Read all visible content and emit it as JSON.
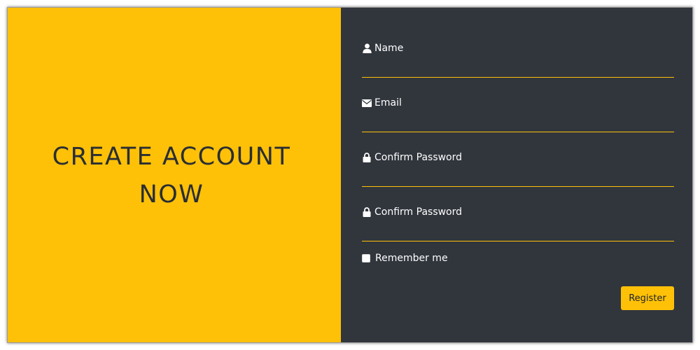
{
  "headline": {
    "line1": "CREATE ACCOUNT",
    "line2": "NOW"
  },
  "form": {
    "fields": [
      {
        "label": "Name",
        "icon": "user-icon",
        "value": "",
        "placeholder": ""
      },
      {
        "label": "Email",
        "icon": "envelope-icon",
        "value": "",
        "placeholder": ""
      },
      {
        "label": "Confirm Password",
        "icon": "lock-icon",
        "value": "",
        "placeholder": ""
      },
      {
        "label": "Confirm Password",
        "icon": "lock-icon",
        "value": "",
        "placeholder": ""
      }
    ],
    "remember_label": "Remember me",
    "remember_checked": false,
    "register_label": "Register"
  },
  "colors": {
    "accent": "#ffc107",
    "panel_dark": "#31363d",
    "headline_text": "#2a2e33",
    "label_text": "#ffffff"
  }
}
